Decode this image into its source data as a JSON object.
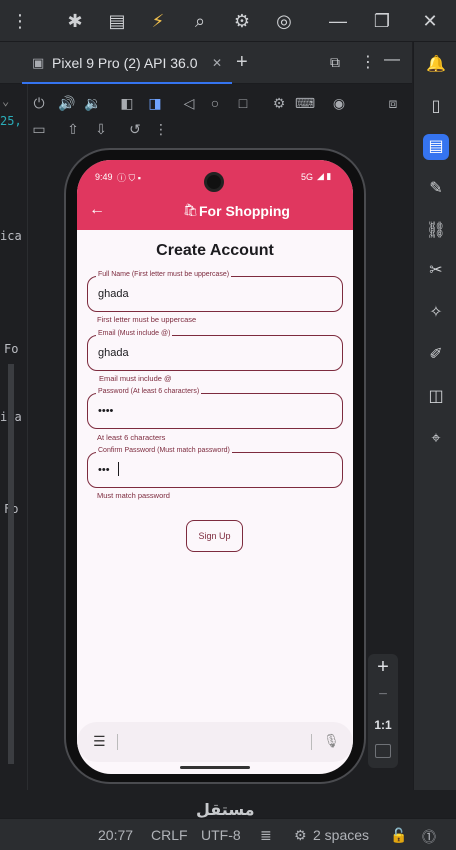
{
  "ide": {
    "device_tab": "Pixel 9 Pro (2) API 36.0",
    "left_code": [
      "25,",
      "ica",
      "Fo",
      "ica",
      "Fo"
    ],
    "status": {
      "position": "20:77",
      "line_sep": "CRLF",
      "encoding": "UTF-8",
      "indent": "2 spaces"
    },
    "zoom": {
      "plus": "+",
      "minus": "−",
      "ratio": "1:1"
    },
    "watermark": "مستقل"
  },
  "phone": {
    "time": "9:49",
    "network": "5G",
    "app_title": "For Shopping",
    "page_title": "Create Account",
    "fields": [
      {
        "label": "Full Name (First letter must be uppercase)",
        "value": "ghada",
        "helper": "First letter must be uppercase"
      },
      {
        "label": "Email (Must include @)",
        "value": "ghada",
        "helper": "Email must include @"
      },
      {
        "label": "Password (At least 6 characters)",
        "value": "••••",
        "helper": "At least 6 characters"
      },
      {
        "label": "Confirm Password (Must match password)",
        "value": "•••",
        "helper": "Must match password"
      }
    ],
    "signup_label": "Sign Up"
  },
  "colors": {
    "accent": "#e0375f",
    "field_border": "#7d2b3e",
    "ide_blue": "#3574f0"
  }
}
